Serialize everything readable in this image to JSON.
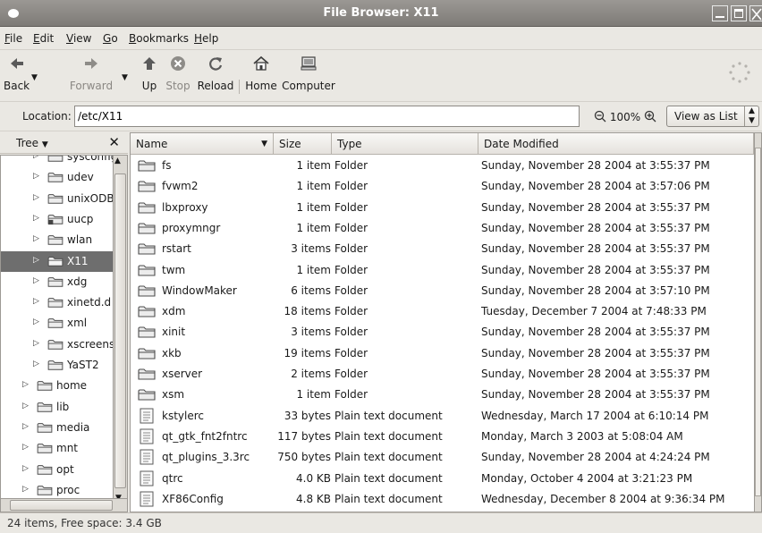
{
  "window": {
    "title": "File Browser: X11"
  },
  "menu": [
    {
      "label": "File",
      "u": "F",
      "rest": "ile"
    },
    {
      "label": "Edit",
      "u": "E",
      "rest": "dit"
    },
    {
      "label": "View",
      "u": "V",
      "rest": "iew"
    },
    {
      "label": "Go",
      "u": "G",
      "rest": "o"
    },
    {
      "label": "Bookmarks",
      "u": "B",
      "rest": "ookmarks"
    },
    {
      "label": "Help",
      "u": "H",
      "rest": "elp"
    }
  ],
  "toolbar": {
    "back": "Back",
    "forward": "Forward",
    "up": "Up",
    "stop": "Stop",
    "reload": "Reload",
    "home": "Home",
    "computer": "Computer"
  },
  "location": {
    "label": "Location:",
    "value": "/etc/X11",
    "zoom": "100%",
    "view_as": "View as List"
  },
  "sidebar": {
    "title": "Tree",
    "items": [
      {
        "name": "sysconfig",
        "depth": 1,
        "selected": false
      },
      {
        "name": "udev",
        "depth": 1,
        "selected": false
      },
      {
        "name": "unixODB",
        "depth": 1,
        "selected": false
      },
      {
        "name": "uucp",
        "depth": 1,
        "selected": false,
        "locked": true
      },
      {
        "name": "wlan",
        "depth": 1,
        "selected": false
      },
      {
        "name": "X11",
        "depth": 1,
        "selected": true
      },
      {
        "name": "xdg",
        "depth": 1,
        "selected": false
      },
      {
        "name": "xinetd.d",
        "depth": 1,
        "selected": false
      },
      {
        "name": "xml",
        "depth": 1,
        "selected": false
      },
      {
        "name": "xscreens",
        "depth": 1,
        "selected": false
      },
      {
        "name": "YaST2",
        "depth": 1,
        "selected": false
      },
      {
        "name": "home",
        "depth": 0,
        "selected": false
      },
      {
        "name": "lib",
        "depth": 0,
        "selected": false
      },
      {
        "name": "media",
        "depth": 0,
        "selected": false
      },
      {
        "name": "mnt",
        "depth": 0,
        "selected": false
      },
      {
        "name": "opt",
        "depth": 0,
        "selected": false
      },
      {
        "name": "proc",
        "depth": 0,
        "selected": false
      }
    ]
  },
  "columns": {
    "name": "Name",
    "size": "Size",
    "type": "Type",
    "date": "Date Modified"
  },
  "files": [
    {
      "name": "fs",
      "size": "1 item",
      "type": "Folder",
      "date": "Sunday, November 28 2004 at 3:55:37 PM",
      "kind": "folder"
    },
    {
      "name": "fvwm2",
      "size": "1 item",
      "type": "Folder",
      "date": "Sunday, November 28 2004 at 3:57:06 PM",
      "kind": "folder"
    },
    {
      "name": "lbxproxy",
      "size": "1 item",
      "type": "Folder",
      "date": "Sunday, November 28 2004 at 3:55:37 PM",
      "kind": "folder"
    },
    {
      "name": "proxymngr",
      "size": "1 item",
      "type": "Folder",
      "date": "Sunday, November 28 2004 at 3:55:37 PM",
      "kind": "folder"
    },
    {
      "name": "rstart",
      "size": "3 items",
      "type": "Folder",
      "date": "Sunday, November 28 2004 at 3:55:37 PM",
      "kind": "folder"
    },
    {
      "name": "twm",
      "size": "1 item",
      "type": "Folder",
      "date": "Sunday, November 28 2004 at 3:55:37 PM",
      "kind": "folder"
    },
    {
      "name": "WindowMaker",
      "size": "6 items",
      "type": "Folder",
      "date": "Sunday, November 28 2004 at 3:57:10 PM",
      "kind": "folder"
    },
    {
      "name": "xdm",
      "size": "18 items",
      "type": "Folder",
      "date": "Tuesday, December 7 2004 at 7:48:33 PM",
      "kind": "folder"
    },
    {
      "name": "xinit",
      "size": "3 items",
      "type": "Folder",
      "date": "Sunday, November 28 2004 at 3:55:37 PM",
      "kind": "folder"
    },
    {
      "name": "xkb",
      "size": "19 items",
      "type": "Folder",
      "date": "Sunday, November 28 2004 at 3:55:37 PM",
      "kind": "folder"
    },
    {
      "name": "xserver",
      "size": "2 items",
      "type": "Folder",
      "date": "Sunday, November 28 2004 at 3:55:37 PM",
      "kind": "folder"
    },
    {
      "name": "xsm",
      "size": "1 item",
      "type": "Folder",
      "date": "Sunday, November 28 2004 at 3:55:37 PM",
      "kind": "folder"
    },
    {
      "name": "kstylerc",
      "size": "33 bytes",
      "type": "Plain text document",
      "date": "Wednesday, March 17 2004 at 6:10:14 PM",
      "kind": "text"
    },
    {
      "name": "qt_gtk_fnt2fntrc",
      "size": "117 bytes",
      "type": "Plain text document",
      "date": "Monday, March 3 2003 at 5:08:04 AM",
      "kind": "text"
    },
    {
      "name": "qt_plugins_3.3rc",
      "size": "750 bytes",
      "type": "Plain text document",
      "date": "Sunday, November 28 2004 at 4:24:24 PM",
      "kind": "text"
    },
    {
      "name": "qtrc",
      "size": "4.0 KB",
      "type": "Plain text document",
      "date": "Monday, October 4 2004 at 3:21:23 PM",
      "kind": "text"
    },
    {
      "name": "XF86Config",
      "size": "4.8 KB",
      "type": "Plain text document",
      "date": "Wednesday, December 8 2004 at 9:36:34 PM",
      "kind": "text"
    }
  ],
  "status": "24 items, Free space: 3.4 GB"
}
